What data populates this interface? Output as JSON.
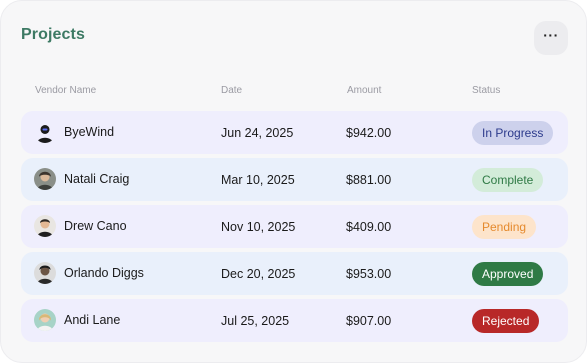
{
  "header": {
    "title": "Projects",
    "more_label": "···"
  },
  "table": {
    "columns": [
      "Vendor Name",
      "Date",
      "Amount",
      "Status"
    ],
    "rows": [
      {
        "vendor": "ByeWind",
        "date": "Jun 24, 2025",
        "amount": "$942.00",
        "status": "In Progress"
      },
      {
        "vendor": "Natali Craig",
        "date": "Mar 10, 2025",
        "amount": "$881.00",
        "status": "Complete"
      },
      {
        "vendor": "Drew Cano",
        "date": "Nov 10, 2025",
        "amount": "$409.00",
        "status": "Pending"
      },
      {
        "vendor": "Orlando Diggs",
        "date": "Dec 20, 2025",
        "amount": "$953.00",
        "status": "Approved"
      },
      {
        "vendor": "Andi Lane",
        "date": "Jul 25, 2025",
        "amount": "$907.00",
        "status": "Rejected"
      }
    ]
  },
  "status_colors": {
    "In Progress": {
      "bg": "#cdd1ec",
      "fg": "#2c3a8c"
    },
    "Complete": {
      "bg": "#d3ecd9",
      "fg": "#2f7a45"
    },
    "Pending": {
      "bg": "#fde4cb",
      "fg": "#e58a2e"
    },
    "Approved": {
      "bg": "#2f7a45",
      "fg": "#ffffff"
    },
    "Rejected": {
      "bg": "#b82828",
      "fg": "#ffffff"
    }
  },
  "colors": {
    "title": "#3d7a64",
    "row_lavender": "#efeefd",
    "row_blue": "#e9f0fb"
  }
}
